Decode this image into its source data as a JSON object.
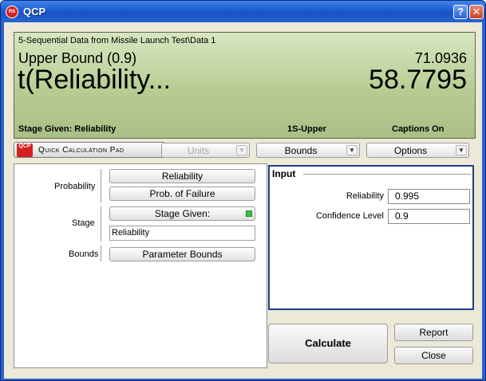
{
  "window": {
    "title": "QCP",
    "logo_text": "RS",
    "help_label": "?",
    "close_label": "✕"
  },
  "display": {
    "source": "5-Sequential Data from Missile Launch Test\\Data 1",
    "bound_label": "Upper Bound (0.9)",
    "bound_value": "71.0936",
    "main_label": "t(Reliability...",
    "main_value": "58.7795",
    "status": {
      "stage": "Stage Given: Reliability",
      "side": "1S-Upper",
      "captions": "Captions On"
    }
  },
  "toolbar": {
    "qcp_icon_text": "QCP",
    "qcp_label": "Quick Calculation Pad",
    "units_label": "Units",
    "bounds_label": "Bounds",
    "options_label": "Options",
    "arrow": "▼"
  },
  "left_panel": {
    "probability_label": "Probability",
    "reliability_button": "Reliability",
    "prob_failure_button": "Prob. of Failure",
    "stage_label": "Stage",
    "stage_given_button": "Stage Given:",
    "stage_value": "Reliability",
    "bounds_label": "Bounds",
    "parameter_bounds_button": "Parameter Bounds"
  },
  "input_panel": {
    "title": "Input",
    "reliability_label": "Reliability",
    "reliability_value": "0.995",
    "confidence_label": "Confidence Level",
    "confidence_value": "0.9"
  },
  "actions": {
    "calculate": "Calculate",
    "report": "Report",
    "close": "Close"
  },
  "colors": {
    "title_bar": "#1c5bd0",
    "display_background": "#b7cc93",
    "input_panel_border": "#1f3f8a",
    "stage_indicator": "#3cc23c"
  }
}
